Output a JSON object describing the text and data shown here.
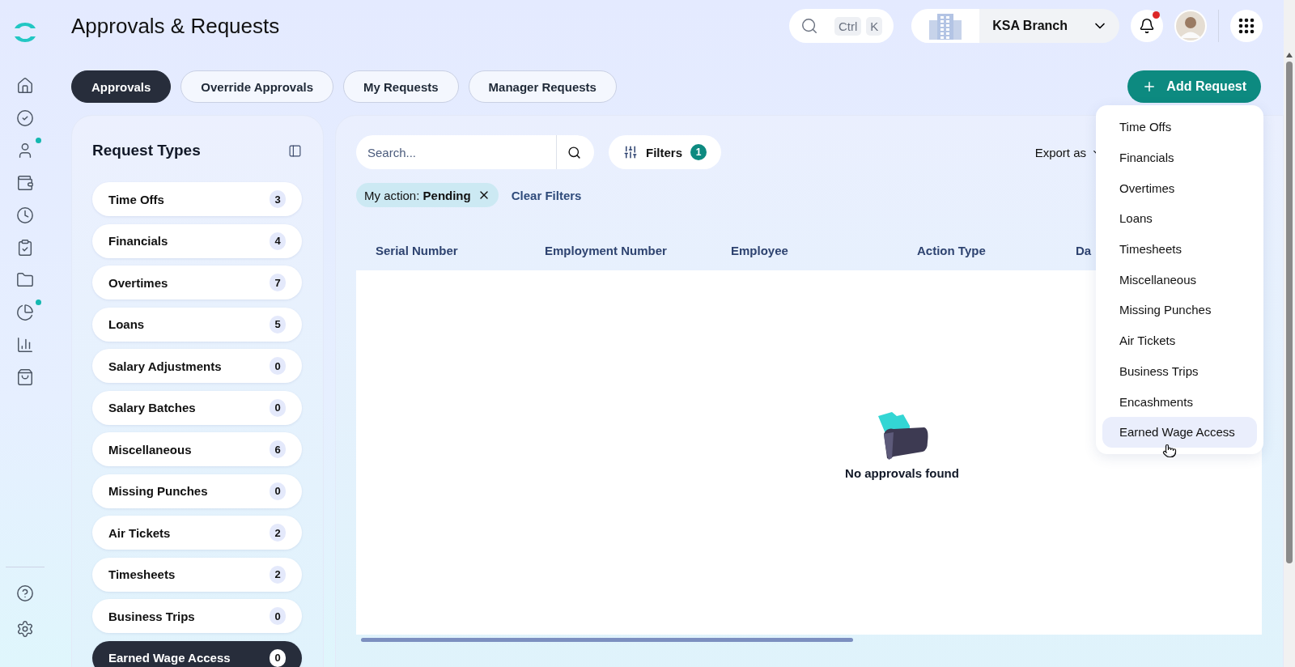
{
  "header": {
    "title": "Approvals & Requests",
    "search": {
      "keys": [
        "Ctrl",
        "K"
      ]
    },
    "branch": {
      "name": "KSA Branch"
    },
    "notifications": {
      "unread": true
    }
  },
  "nav": {
    "items": [
      {
        "dot": false
      },
      {
        "dot": false
      },
      {
        "dot": true
      },
      {
        "dot": false
      },
      {
        "dot": false
      },
      {
        "dot": false
      },
      {
        "dot": false
      },
      {
        "dot": true
      },
      {
        "dot": false
      },
      {
        "dot": false
      }
    ]
  },
  "tabs": [
    {
      "label": "Approvals",
      "selected": true
    },
    {
      "label": "Override Approvals",
      "selected": false
    },
    {
      "label": "My Requests",
      "selected": false
    },
    {
      "label": "Manager Requests",
      "selected": false
    }
  ],
  "add_button": {
    "label": "Add Request"
  },
  "request_types": {
    "title": "Request Types",
    "items": [
      {
        "label": "Time Offs",
        "count": "3",
        "selected": false
      },
      {
        "label": "Financials",
        "count": "4",
        "selected": false
      },
      {
        "label": "Overtimes",
        "count": "7",
        "selected": false
      },
      {
        "label": "Loans",
        "count": "5",
        "selected": false
      },
      {
        "label": "Salary Adjustments",
        "count": "0",
        "selected": false
      },
      {
        "label": "Salary Batches",
        "count": "0",
        "selected": false
      },
      {
        "label": "Miscellaneous",
        "count": "6",
        "selected": false
      },
      {
        "label": "Missing Punches",
        "count": "0",
        "selected": false
      },
      {
        "label": "Air Tickets",
        "count": "2",
        "selected": false
      },
      {
        "label": "Timesheets",
        "count": "2",
        "selected": false
      },
      {
        "label": "Business Trips",
        "count": "0",
        "selected": false
      },
      {
        "label": "Earned Wage Access",
        "count": "0",
        "selected": true
      }
    ]
  },
  "toolbar": {
    "search": {
      "placeholder": "Search..."
    },
    "filters": {
      "label": "Filters",
      "count": "1"
    },
    "export": {
      "label": "Export as"
    }
  },
  "active_filters": [
    {
      "name": "My action:",
      "value": "Pending"
    }
  ],
  "clear_filters": "Clear Filters",
  "table": {
    "columns": [
      "Serial Number",
      "Employment Number",
      "Employee",
      "Action Type",
      "Da"
    ],
    "empty_message": "No approvals found"
  },
  "add_menu": {
    "items": [
      {
        "label": "Time Offs",
        "highlighted": false
      },
      {
        "label": "Financials",
        "highlighted": false
      },
      {
        "label": "Overtimes",
        "highlighted": false
      },
      {
        "label": "Loans",
        "highlighted": false
      },
      {
        "label": "Timesheets",
        "highlighted": false
      },
      {
        "label": "Miscellaneous",
        "highlighted": false
      },
      {
        "label": "Missing Punches",
        "highlighted": false
      },
      {
        "label": "Air Tickets",
        "highlighted": false
      },
      {
        "label": "Business Trips",
        "highlighted": false
      },
      {
        "label": "Encashments",
        "highlighted": false
      },
      {
        "label": "Earned Wage Access",
        "highlighted": true
      }
    ]
  }
}
